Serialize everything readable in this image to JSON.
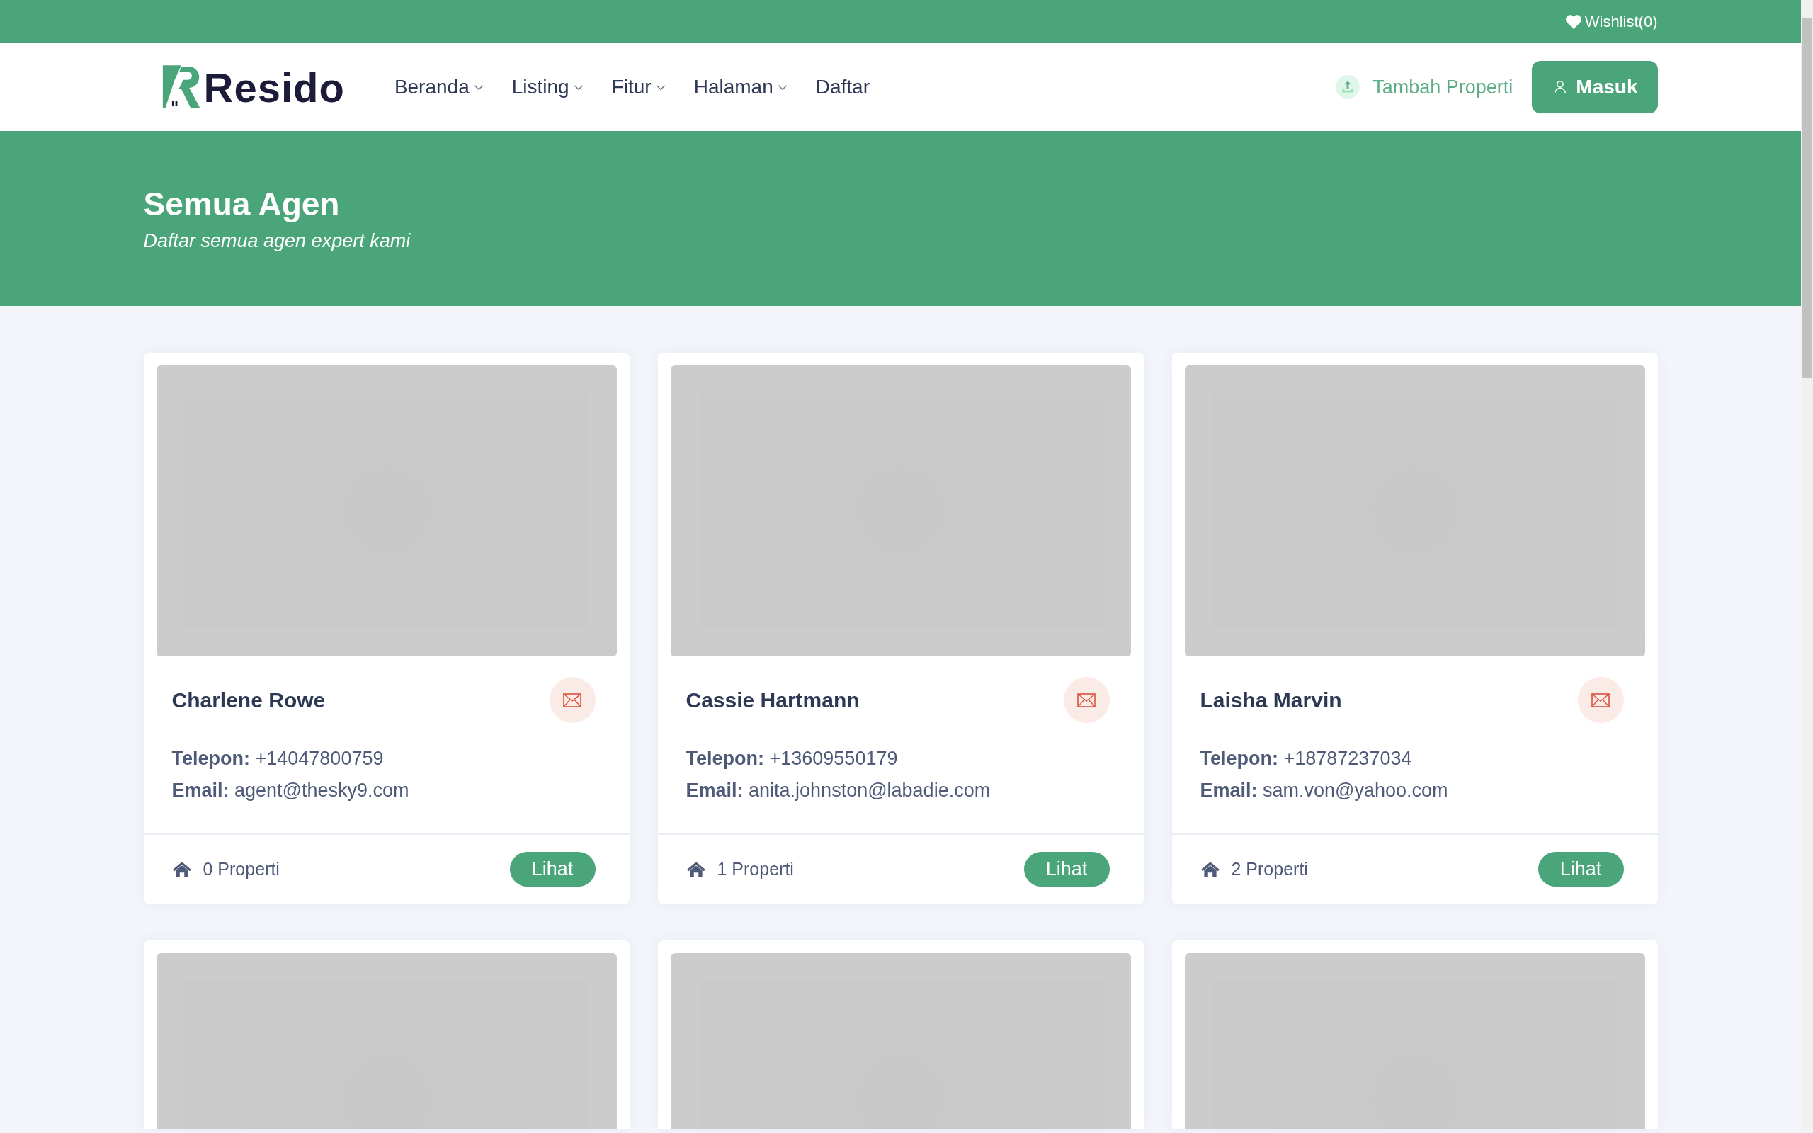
{
  "top_bar": {
    "wishlist": "Wishlist(0)"
  },
  "nav": {
    "logo": "Resido",
    "items": [
      {
        "label": "Beranda",
        "dropdown": true
      },
      {
        "label": "Listing",
        "dropdown": true
      },
      {
        "label": "Fitur",
        "dropdown": true
      },
      {
        "label": "Halaman",
        "dropdown": true
      },
      {
        "label": "Daftar",
        "dropdown": false
      }
    ],
    "add_property": "Tambah Properti",
    "login": "Masuk"
  },
  "hero": {
    "title": "Semua Agen",
    "subtitle": "Daftar semua agen expert kami"
  },
  "agents": [
    {
      "kind": "full",
      "name": "Charlene Rowe",
      "phone": "**Telepon:** +14047800759",
      "email": "**Email:** agent@thesky9.com",
      "properties": "0 Properti",
      "view": "Lihat"
    },
    {
      "kind": "full",
      "name": "Cassie Hartmann",
      "phone": "**Telepon:** +13609550179",
      "email": "**Email:** anita.johnston@labadie.com",
      "properties": "1 Properti",
      "view": "Lihat"
    },
    {
      "kind": "full",
      "name": "Laisha Marvin",
      "phone": "**Telepon:** +18787237034",
      "email": "**Email:** sam.von@yahoo.com",
      "properties": "2 Properti",
      "view": "Lihat"
    },
    {
      "kind": "picture"
    },
    {
      "kind": "picture"
    },
    {
      "kind": "picture"
    }
  ]
}
